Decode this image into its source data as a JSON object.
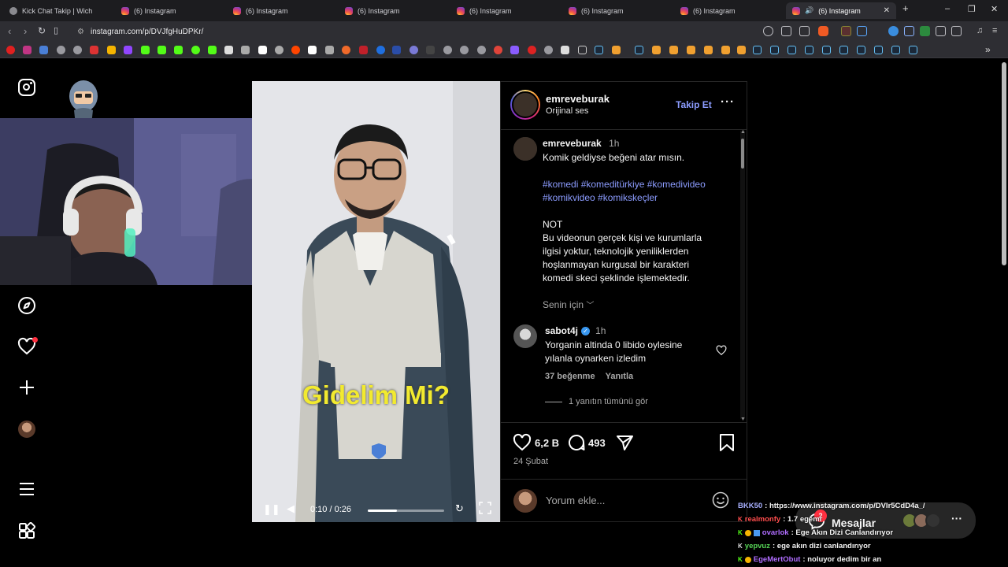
{
  "browser": {
    "tabs": [
      {
        "label": "Kick Chat Takip | Wich",
        "icon": "kick-icon",
        "active": false
      },
      {
        "label": "(6) Instagram",
        "icon": "instagram-icon",
        "active": false
      },
      {
        "label": "(6) Instagram",
        "icon": "instagram-icon",
        "active": false
      },
      {
        "label": "(6) Instagram",
        "icon": "instagram-icon",
        "active": false
      },
      {
        "label": "(6) Instagram",
        "icon": "instagram-icon",
        "active": false
      },
      {
        "label": "(6) Instagram",
        "icon": "instagram-icon",
        "active": false
      },
      {
        "label": "(6) Instagram",
        "icon": "instagram-icon",
        "active": false
      },
      {
        "label": "(6) Instagram",
        "icon": "instagram-icon",
        "active": true
      }
    ],
    "url": "instagram.com/p/DVJfgHuDPKr/",
    "new_tab": "+",
    "window_controls": [
      "–",
      "❐",
      "✕"
    ]
  },
  "post": {
    "username": "emreveburak",
    "audio": "Orijinal ses",
    "follow_label": "Takip Et",
    "caption": {
      "username": "emreveburak",
      "time": "1h",
      "text": "Komik geldiyse beğeni atar mısın.",
      "hashtags_line1": "#komedi #komeditürkiye #komedivideo",
      "hashtags_line2": "#komikvideo #komikskeçler",
      "note_title": "NOT",
      "note_lines": [
        "Bu videonun gerçek kişi ve kurumlarla",
        "ilgisi yoktur, teknolojik yeniliklerden",
        "hoşlanmayan kurgusal bir karakteri",
        "komedi skeci şeklinde işlemektedir."
      ]
    },
    "sort_label": "Senin için",
    "comment": {
      "username": "sabot4j",
      "time": "1h",
      "lines": [
        "Yorganin altinda 0 libido oylesine",
        "yılanla oynarken izledim"
      ],
      "likes": "37 beğenme",
      "reply_label": "Yanıtla",
      "view_replies": "1 yanıtın tümünü gör"
    },
    "likes": "6,2 B",
    "comments_count": "493",
    "date": "24 Şubat",
    "comment_placeholder": "Yorum ekle..."
  },
  "video": {
    "caption_text": "Gidelim Mi?",
    "time": "0:10 / 0:26",
    "progress": 0.38
  },
  "messages": {
    "label": "Mesajlar",
    "badge": "2"
  },
  "chat": [
    {
      "user": "BKK50",
      "text": ": https://www.instagram.com/p/DVIr5CdD4a_/",
      "color": "#9aa0ff"
    },
    {
      "user": "realmonfy",
      "text": ": 1.7 egemi",
      "color": "#ff4d4d"
    },
    {
      "user": "ovarlok",
      "text": ": Ege Akın Dizi Canlandırıyor",
      "color": "#b06dff"
    },
    {
      "user": "yepvuz",
      "text": ": ege akın dizi canlandırıyor",
      "color": "#57d657"
    },
    {
      "user": "EgeMertObut",
      "text": ": noluyor dedim bir an",
      "color": "#b06dff"
    }
  ]
}
